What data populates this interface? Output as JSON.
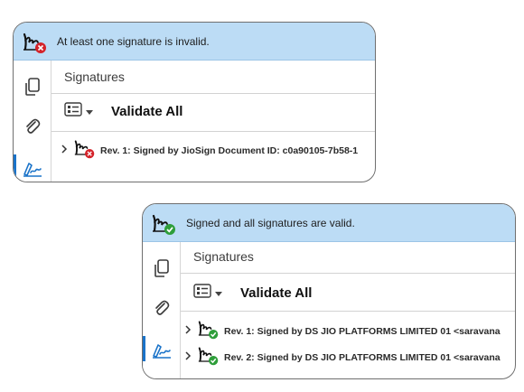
{
  "invalid_panel": {
    "banner": "At least one signature is invalid.",
    "title": "Signatures",
    "validate_all": "Validate All",
    "rows": [
      {
        "label": "Rev. 1: Signed by JioSign Document ID: c0a90105-7b58-1"
      }
    ]
  },
  "valid_panel": {
    "banner": "Signed and all signatures are valid.",
    "title": "Signatures",
    "validate_all": "Validate All",
    "rows": [
      {
        "label": "Rev. 1: Signed by DS JIO PLATFORMS LIMITED 01 <saravana"
      },
      {
        "label": "Rev. 2: Signed by DS JIO PLATFORMS LIMITED 01 <saravana"
      }
    ]
  },
  "icons": {
    "signature": "signature-pen-icon",
    "invalid_badge": "red-x-badge-icon",
    "valid_badge": "green-check-badge-icon",
    "pages": "pages-copy-icon",
    "attachment": "paperclip-icon",
    "signature_panel": "signature-panel-icon",
    "options": "options-list-icon",
    "dropdown": "caret-down-icon",
    "expand": "chevron-right-icon"
  },
  "colors": {
    "banner_bg": "#bcdcf5",
    "invalid": "#d4232a",
    "valid": "#2e9e3a",
    "active_tool": "#1a73c9"
  }
}
